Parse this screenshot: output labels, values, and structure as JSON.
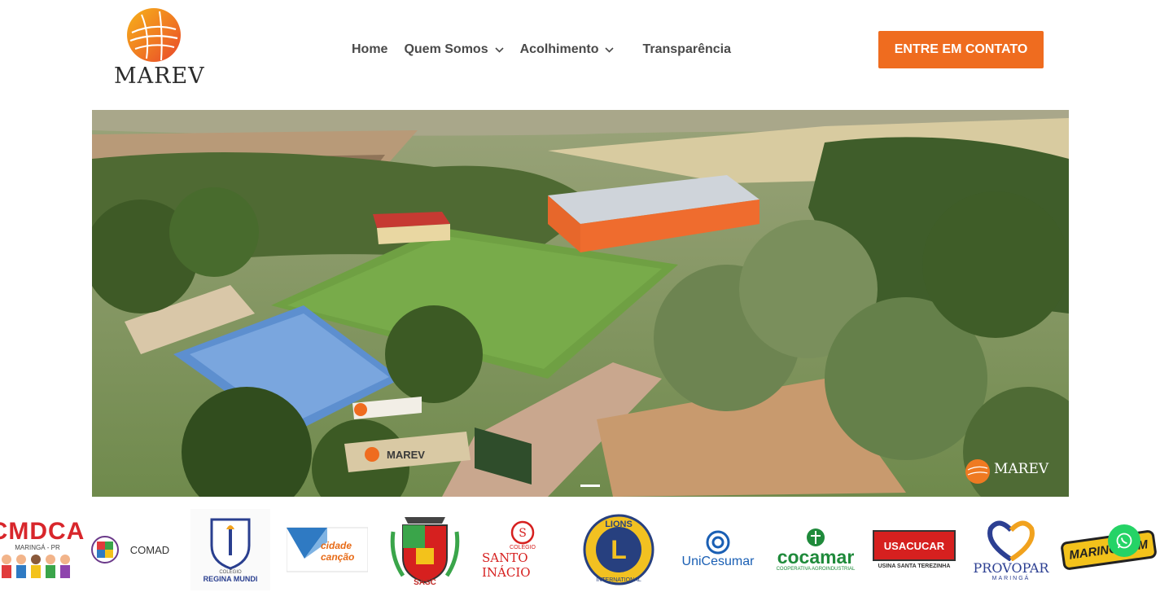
{
  "brand": {
    "name": "MAREV"
  },
  "nav": {
    "items": [
      {
        "label": "Home"
      },
      {
        "label": "Quem Somos"
      },
      {
        "label": "Acolhimento"
      },
      {
        "label": "Transparência"
      }
    ]
  },
  "cta": {
    "label": "ENTRE EM CONTATO"
  },
  "hero": {
    "sign_text": "MAREV",
    "watermark": "MAREV"
  },
  "partners": [
    {
      "name": "CMDCA",
      "sub": "MARINGÁ - PR"
    },
    {
      "name": "COMAD"
    },
    {
      "name": "REGINA MUNDI",
      "sub": "COLÉGIO"
    },
    {
      "name": "cidade canção"
    },
    {
      "name": "SASC"
    },
    {
      "name": "SANTO INÁCIO",
      "sub": "COLÉGIO"
    },
    {
      "name": "LIONS",
      "sub": "INTERNATIONAL"
    },
    {
      "name": "UniCesumar"
    },
    {
      "name": "cocamar",
      "sub": "COOPERATIVA AGROINDUSTRIAL"
    },
    {
      "name": "USACUCAR",
      "sub": "USINA SANTA TEREZINHA"
    },
    {
      "name": "PROVOPAR",
      "sub": "MARINGÁ"
    },
    {
      "name": "MARINGÁ FM"
    }
  ],
  "colors": {
    "accent": "#ef6c1f",
    "whatsapp": "#25d366",
    "nav_text": "#4a4a4a"
  },
  "icons": {
    "whatsapp": "whatsapp-icon",
    "chevron": "chevron-down-icon"
  }
}
